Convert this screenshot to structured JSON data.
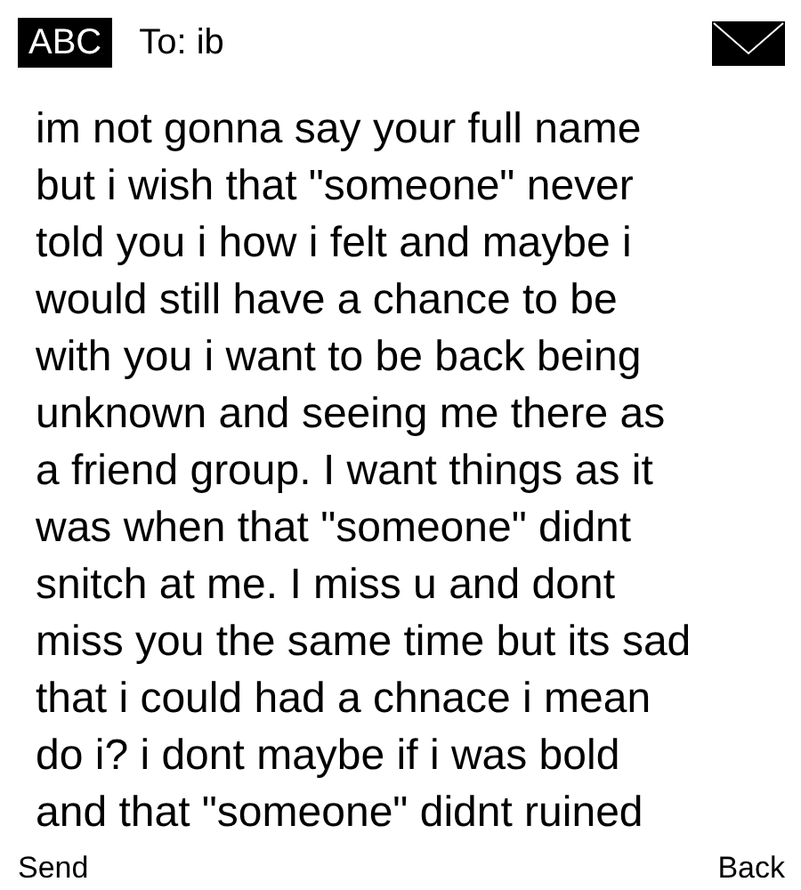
{
  "header": {
    "input_mode": "ABC",
    "recipient": "To: ib"
  },
  "message_lines": [
    "im not gonna say your full name",
    "but i wish that \"someone\" never",
    "told you i how i felt and maybe i",
    "would still have a chance to be",
    "with you i want to be back being",
    "unknown and seeing me there as",
    "a friend group. I want things as it",
    "was when that \"someone\" didnt",
    "snitch at me. I miss u and dont",
    "miss you the same time but its sad",
    "that i could had a chnace i mean",
    "do i? i dont maybe if i was bold",
    "and that \"someone\" didnt ruined"
  ],
  "softkeys": {
    "left": "Send",
    "right": "Back"
  }
}
